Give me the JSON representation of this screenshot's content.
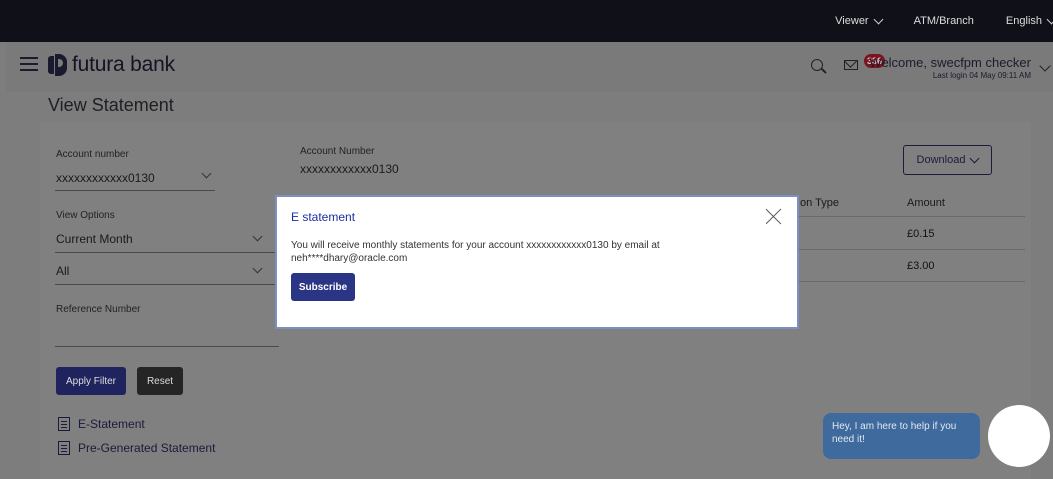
{
  "topbar": {
    "viewer": "Viewer",
    "atm_branch": "ATM/Branch",
    "language": "English"
  },
  "header": {
    "brand": "futura bank",
    "notification_count": "336",
    "welcome": "Welcome, swecfpm checker",
    "last_login": "Last login 04 May 09:11 AM"
  },
  "page": {
    "title": "View Statement"
  },
  "filters": {
    "account_label": "Account number",
    "account_value": "xxxxxxxxxxxx0130",
    "view_options_label": "View Options",
    "view_option_value": "Current Month",
    "type_value": "All",
    "reference_label": "Reference Number",
    "reference_value": "",
    "apply_label": "Apply Filter",
    "reset_label": "Reset"
  },
  "details": {
    "account_number_label": "Account Number",
    "account_number_value": "xxxxxxxxxxxx0130",
    "download_label": "Download"
  },
  "table": {
    "col_type_partial": "on Type",
    "col_amount": "Amount",
    "rows": [
      {
        "amount": "£0.15"
      },
      {
        "amount": "£3.00"
      }
    ]
  },
  "links": {
    "estatement": "E-Statement",
    "pregenerated": "Pre-Generated Statement"
  },
  "modal": {
    "title": "E statement",
    "message": "You will receive monthly statements for your account xxxxxxxxxxxx0130  by email at neh****dhary@oracle.com",
    "subscribe_label": "Subscribe"
  },
  "chat": {
    "message": "Hey, I am here to help if you need it!"
  }
}
